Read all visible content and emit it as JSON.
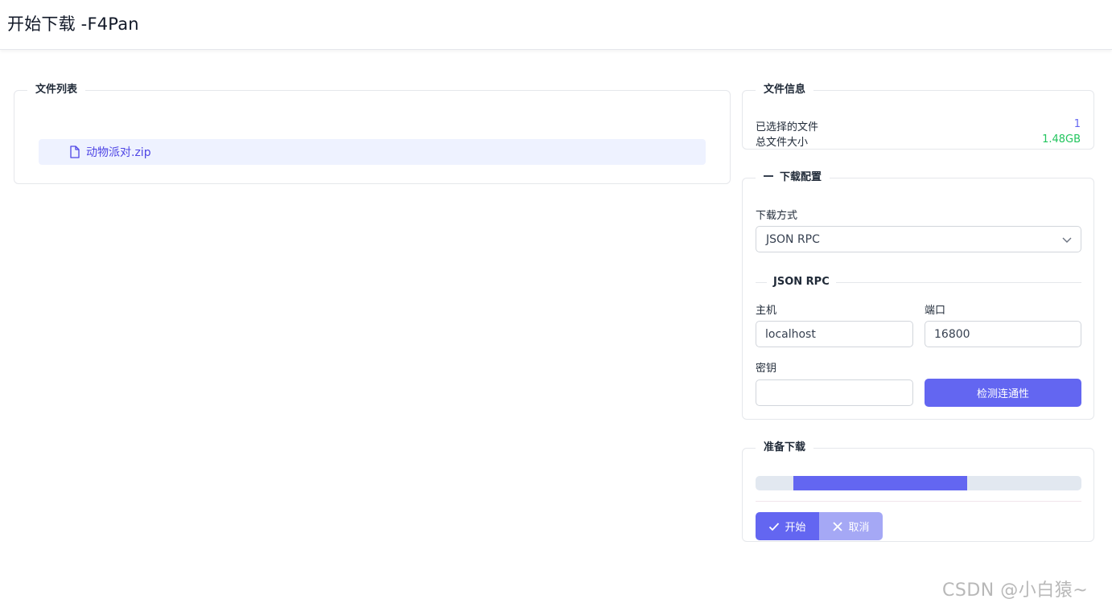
{
  "header": {
    "title": "开始下载 -F4Pan"
  },
  "file_list": {
    "legend": "文件列表",
    "files": [
      {
        "name": "动物派对.zip",
        "icon": "file-icon"
      }
    ]
  },
  "file_info": {
    "legend": "文件信息",
    "selected_label": "已选择的文件",
    "selected_value": "1",
    "size_label": "总文件大小",
    "size_value": "1.48GB"
  },
  "config": {
    "legend": "下载配置",
    "method_label": "下载方式",
    "method_value": "JSON RPC",
    "rpc_section_title": "JSON RPC",
    "host_label": "主机",
    "host_value": "localhost",
    "port_label": "端口",
    "port_value": "16800",
    "secret_label": "密钥",
    "secret_value": "",
    "check_button": "检测连通性"
  },
  "ready": {
    "legend": "准备下载",
    "progress_start": 0.115,
    "progress_end": 0.65,
    "start_button": "开始",
    "cancel_button": "取消"
  },
  "watermark": "CSDN @小白猿~",
  "colors": {
    "accent": "#6366f1",
    "accent_light": "#a5a8f5",
    "success": "#22c55e",
    "highlight": "#eef2ff"
  }
}
